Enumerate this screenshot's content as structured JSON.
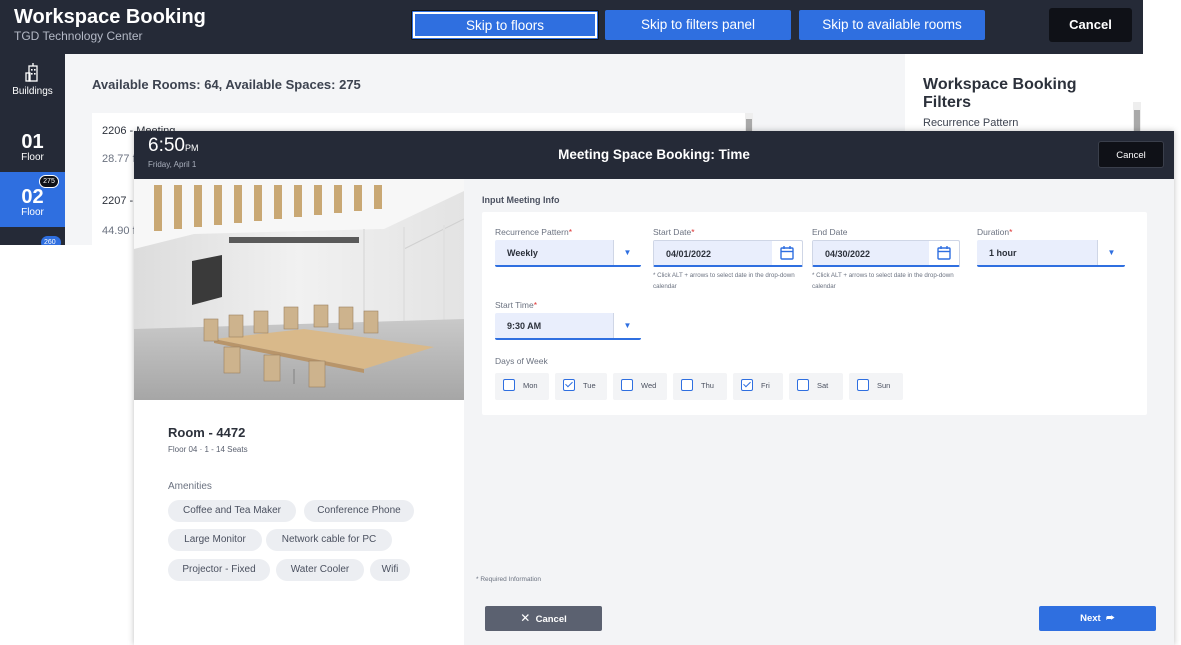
{
  "background": {
    "app_title": "Workspace Booking",
    "app_subtitle": "TGD Technology Center",
    "skip_links": [
      "Skip to floors",
      "Skip to filters panel",
      "Skip to available rooms"
    ],
    "cancel_label": "Cancel",
    "sidebar": {
      "buildings_label": "Buildings",
      "floors": [
        {
          "number": "01",
          "label": "Floor",
          "badge": ""
        },
        {
          "number": "02",
          "label": "Floor",
          "badge": "275"
        }
      ],
      "next_badge": "260"
    },
    "availability": "Available Rooms: 64, Available Spaces: 275",
    "rooms": [
      {
        "name": "2206 - Meeting",
        "size": "28.77 f"
      },
      {
        "name": "2207 -",
        "size": "44.90 f"
      }
    ],
    "filters": {
      "title": "Workspace Booking Filters",
      "first_label": "Recurrence Pattern"
    }
  },
  "modal": {
    "time": "6:50",
    "ampm": "PM",
    "date": "Friday, April 1",
    "title": "Meeting Space Booking: Time",
    "cancel_label": "Cancel",
    "room": {
      "title": "Room - 4472",
      "meta": "Floor 04  ·  1 - 14 Seats",
      "amenities_heading": "Amenities",
      "amenities": [
        "Coffee and Tea Maker",
        "Conference Phone",
        "Large Monitor",
        "Network cable for PC",
        "Projector - Fixed",
        "Water Cooler",
        "Wifi"
      ]
    },
    "form": {
      "section_heading": "Input Meeting Info",
      "recurrence": {
        "label": "Recurrence Pattern",
        "value": "Weekly"
      },
      "start_date": {
        "label": "Start Date",
        "value": "04/01/2022"
      },
      "end_date": {
        "label": "End Date",
        "value": "04/30/2022"
      },
      "duration": {
        "label": "Duration",
        "value": "1 hour"
      },
      "start_time": {
        "label": "Start Time",
        "value": "9:30 AM"
      },
      "date_hint": "* Click ALT + arrows to select date in the drop-down calendar",
      "days_label": "Days of Week",
      "days": [
        {
          "label": "Mon",
          "checked": false
        },
        {
          "label": "Tue",
          "checked": true
        },
        {
          "label": "Wed",
          "checked": false
        },
        {
          "label": "Thu",
          "checked": false
        },
        {
          "label": "Fri",
          "checked": true
        },
        {
          "label": "Sat",
          "checked": false
        },
        {
          "label": "Sun",
          "checked": false
        }
      ]
    },
    "required_note": "* Required Information",
    "footer_cancel": "Cancel",
    "footer_next": "Next"
  },
  "colors": {
    "accent": "#2f6fe0",
    "header": "#252a37",
    "required": "#d33333"
  }
}
